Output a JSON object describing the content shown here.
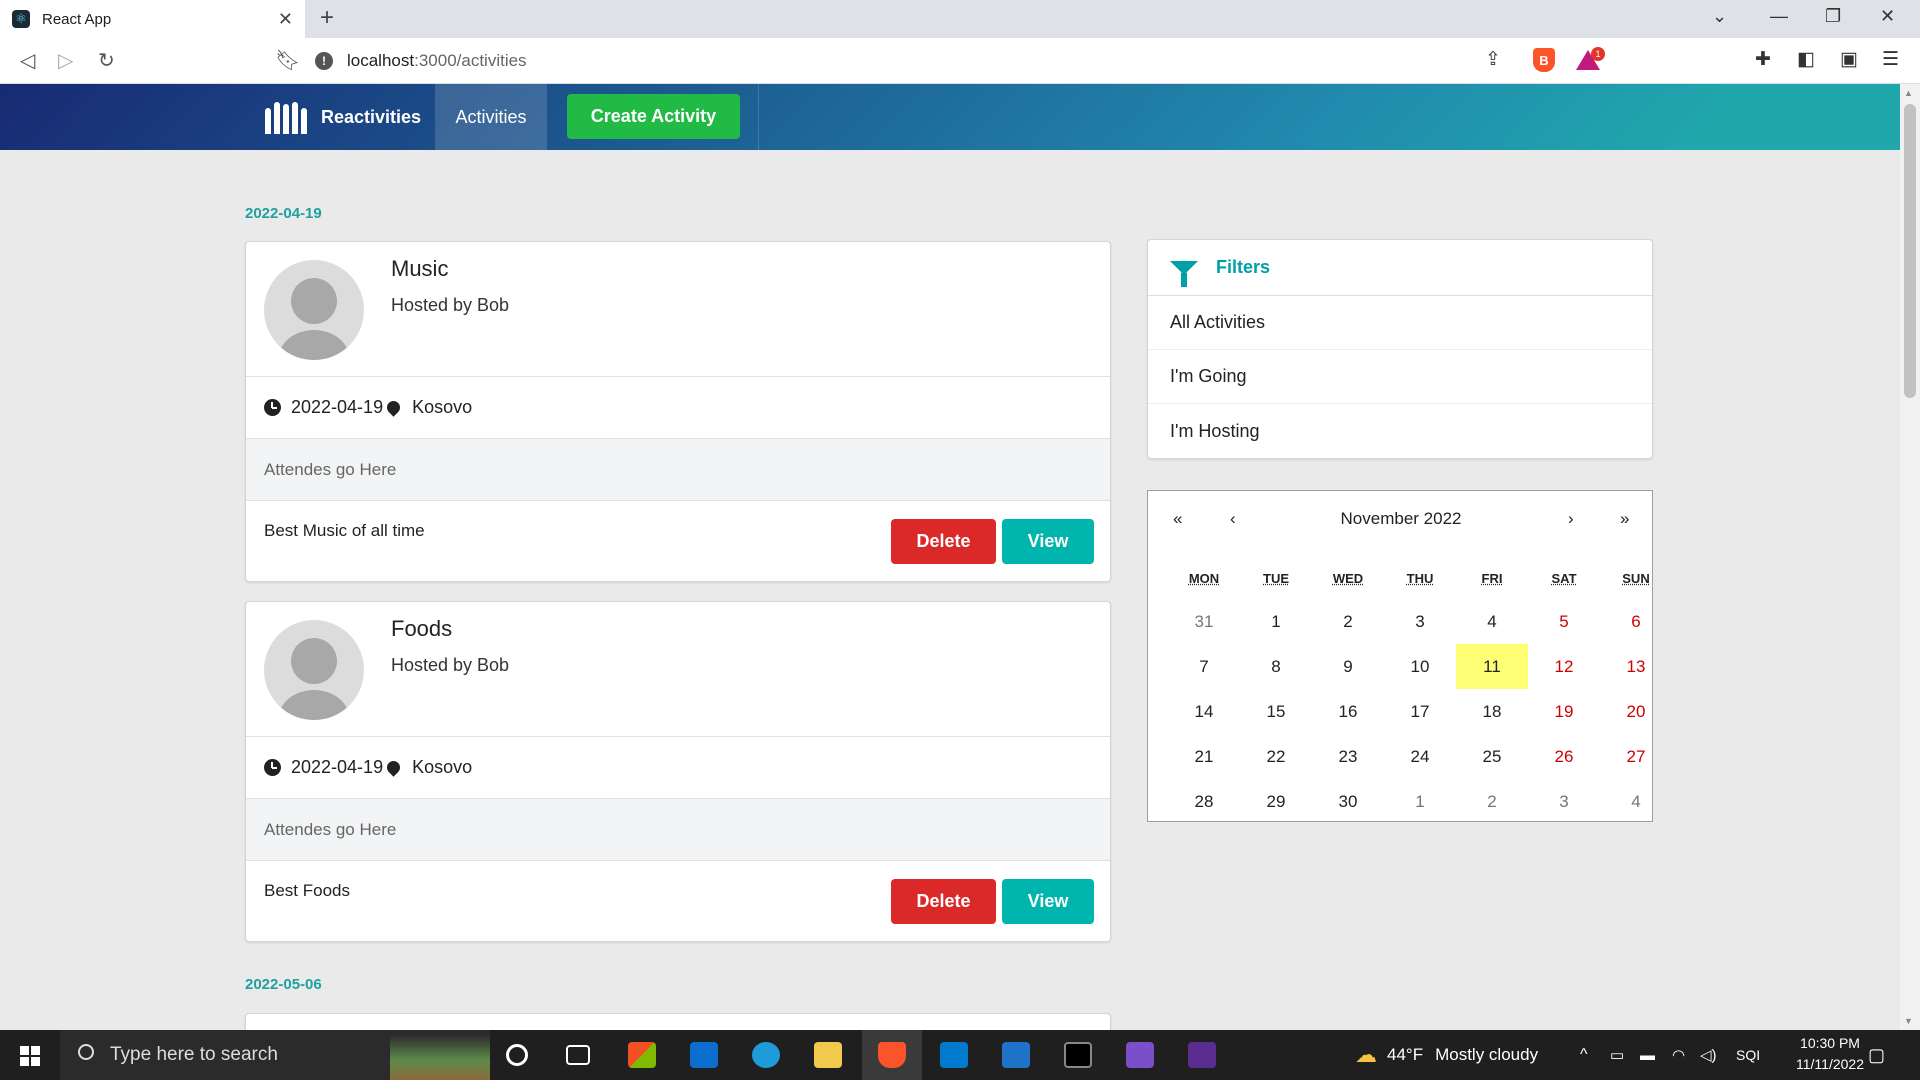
{
  "browser": {
    "tab_title": "React App",
    "tab_close": "✕",
    "new_tab": "+",
    "url_host": "localhost",
    "url_path": ":3000/activities",
    "brave_badge": "1"
  },
  "nav": {
    "brand": "Reactivities",
    "activities": "Activities",
    "create": "Create Activity"
  },
  "groups": [
    {
      "date": "2022-04-19",
      "activities": [
        {
          "title": "Music",
          "host": "Hosted by Bob",
          "date": "2022-04-19",
          "venue": "Kosovo",
          "attendees": "Attendes go Here",
          "description": "Best Music of all time",
          "delete": "Delete",
          "view": "View"
        },
        {
          "title": "Foods",
          "host": "Hosted by Bob",
          "date": "2022-04-19",
          "venue": "Kosovo",
          "attendees": "Attendes go Here",
          "description": "Best Foods",
          "delete": "Delete",
          "view": "View"
        }
      ]
    },
    {
      "date": "2022-05-06"
    }
  ],
  "filters": {
    "header": "Filters",
    "items": [
      "All Activities",
      "I'm Going",
      "I'm Hosting"
    ]
  },
  "calendar": {
    "month": "November 2022",
    "nav": {
      "prev2": "«",
      "prev": "‹",
      "next": "›",
      "next2": "»"
    },
    "weekdays": [
      "MON",
      "TUE",
      "WED",
      "THU",
      "FRI",
      "SAT",
      "SUN"
    ],
    "weeks": [
      [
        "31",
        "1",
        "2",
        "3",
        "4",
        "5",
        "6"
      ],
      [
        "7",
        "8",
        "9",
        "10",
        "11",
        "12",
        "13"
      ],
      [
        "14",
        "15",
        "16",
        "17",
        "18",
        "19",
        "20"
      ],
      [
        "21",
        "22",
        "23",
        "24",
        "25",
        "26",
        "27"
      ],
      [
        "28",
        "29",
        "30",
        "1",
        "2",
        "3",
        "4"
      ]
    ],
    "today": "11"
  },
  "taskbar": {
    "search_placeholder": "Type here to search",
    "weather_temp": "44°F",
    "weather_text": "Mostly cloudy",
    "lang": "SQI",
    "time": "10:30 PM",
    "date": "11/11/2022"
  }
}
